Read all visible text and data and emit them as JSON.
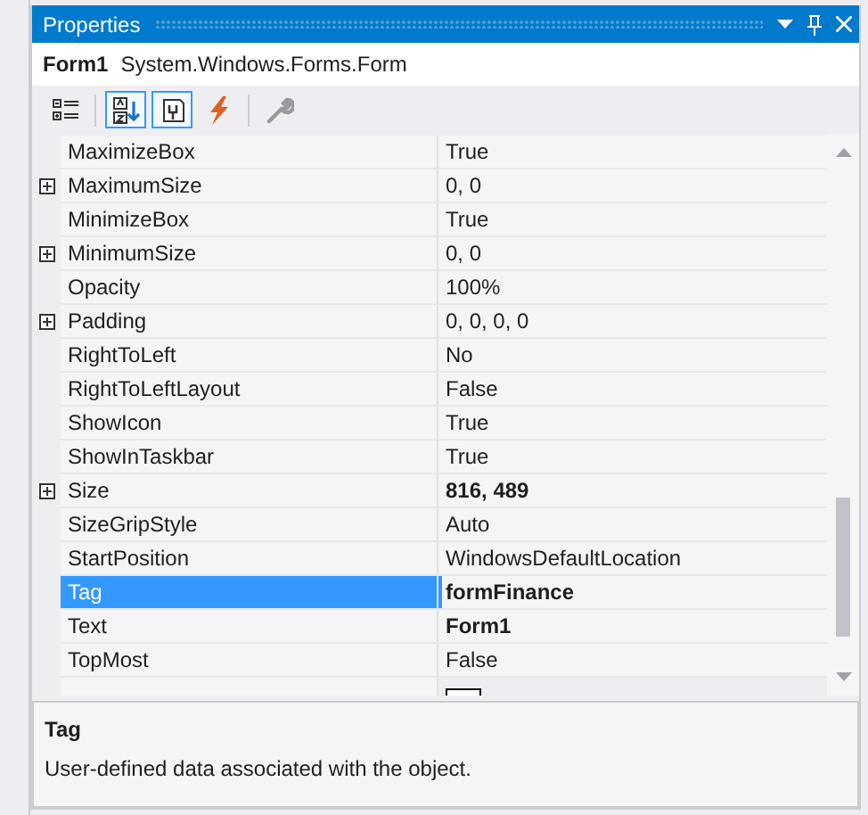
{
  "window": {
    "title": "Properties"
  },
  "object_selector": {
    "name": "Form1",
    "type": "System.Windows.Forms.Form"
  },
  "toolbar": [
    {
      "kind": "categorized",
      "selected": false
    },
    {
      "kind": "alphabetical",
      "selected": true
    },
    {
      "kind": "properties",
      "selected": true
    },
    {
      "kind": "events",
      "selected": false
    },
    {
      "kind": "property-pages",
      "selected": false
    }
  ],
  "properties": [
    {
      "name": "MaximizeBox",
      "value": "True",
      "expandable": false,
      "bold": false,
      "selected": false
    },
    {
      "name": "MaximumSize",
      "value": "0, 0",
      "expandable": true,
      "bold": false,
      "selected": false
    },
    {
      "name": "MinimizeBox",
      "value": "True",
      "expandable": false,
      "bold": false,
      "selected": false
    },
    {
      "name": "MinimumSize",
      "value": "0, 0",
      "expandable": true,
      "bold": false,
      "selected": false
    },
    {
      "name": "Opacity",
      "value": "100%",
      "expandable": false,
      "bold": false,
      "selected": false
    },
    {
      "name": "Padding",
      "value": "0, 0, 0, 0",
      "expandable": true,
      "bold": false,
      "selected": false
    },
    {
      "name": "RightToLeft",
      "value": "No",
      "expandable": false,
      "bold": false,
      "selected": false
    },
    {
      "name": "RightToLeftLayout",
      "value": "False",
      "expandable": false,
      "bold": false,
      "selected": false
    },
    {
      "name": "ShowIcon",
      "value": "True",
      "expandable": false,
      "bold": false,
      "selected": false
    },
    {
      "name": "ShowInTaskbar",
      "value": "True",
      "expandable": false,
      "bold": false,
      "selected": false
    },
    {
      "name": "Size",
      "value": "816, 489",
      "expandable": true,
      "bold": true,
      "selected": false
    },
    {
      "name": "SizeGripStyle",
      "value": "Auto",
      "expandable": false,
      "bold": false,
      "selected": false
    },
    {
      "name": "StartPosition",
      "value": "WindowsDefaultLocation",
      "expandable": false,
      "bold": false,
      "selected": false
    },
    {
      "name": "Tag",
      "value": "formFinance",
      "expandable": false,
      "bold": true,
      "selected": true
    },
    {
      "name": "Text",
      "value": "Form1",
      "expandable": false,
      "bold": true,
      "selected": false
    },
    {
      "name": "TopMost",
      "value": "False",
      "expandable": false,
      "bold": false,
      "selected": false
    }
  ],
  "description": {
    "title": "Tag",
    "text": "User-defined data associated with the object."
  }
}
